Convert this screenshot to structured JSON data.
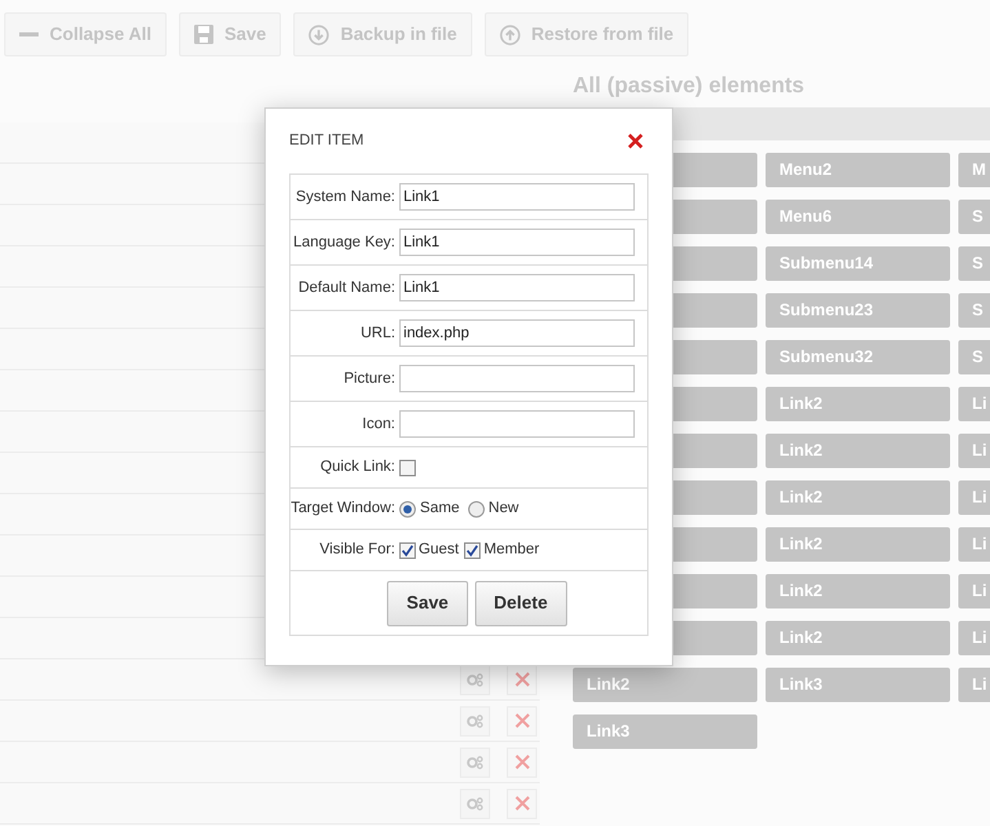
{
  "toolbar": [
    {
      "label": "Collapse All"
    },
    {
      "label": "Save"
    },
    {
      "label": "Backup in file"
    },
    {
      "label": "Restore from file"
    }
  ],
  "passive": {
    "title": "All (passive) elements",
    "rows": [
      [
        null,
        "Menu2",
        "M"
      ],
      [
        null,
        "Menu6",
        "S"
      ],
      [
        null,
        "Submenu14",
        "S"
      ],
      [
        null,
        "Submenu23",
        "S"
      ],
      [
        null,
        "Submenu32",
        "S"
      ],
      [
        null,
        "Link2",
        "Li"
      ],
      [
        null,
        "Link2",
        "Li"
      ],
      [
        null,
        "Link2",
        "Li"
      ],
      [
        null,
        "Link2",
        "Li"
      ],
      [
        null,
        "Link2",
        "Li"
      ],
      [
        null,
        "Link2",
        "Li"
      ],
      [
        "Link2",
        "Link3",
        "Li"
      ],
      [
        "Link3"
      ]
    ]
  },
  "dialog": {
    "title": "EDIT ITEM",
    "fields": [
      {
        "kind": "text",
        "label": "System Name:",
        "value": "Link1"
      },
      {
        "kind": "text",
        "label": "Language Key:",
        "value": "Link1"
      },
      {
        "kind": "text",
        "label": "Default Name:",
        "value": "Link1"
      },
      {
        "kind": "text",
        "label": "URL:",
        "value": "index.php"
      },
      {
        "kind": "text",
        "label": "Picture:"
      },
      {
        "kind": "text",
        "label": "Icon:"
      },
      {
        "kind": "checkbox",
        "label": "Quick Link:",
        "checked": false
      },
      {
        "kind": "radio",
        "label": "Target Window:",
        "options": [
          {
            "label": "Same",
            "selected": true
          },
          {
            "label": "New",
            "selected": false
          }
        ]
      },
      {
        "kind": "checkboxes",
        "label": "Visible For:",
        "options": [
          {
            "label": "Guest",
            "checked": true
          },
          {
            "label": "Member",
            "checked": true
          }
        ]
      }
    ],
    "buttons": [
      "Save",
      "Delete"
    ]
  }
}
